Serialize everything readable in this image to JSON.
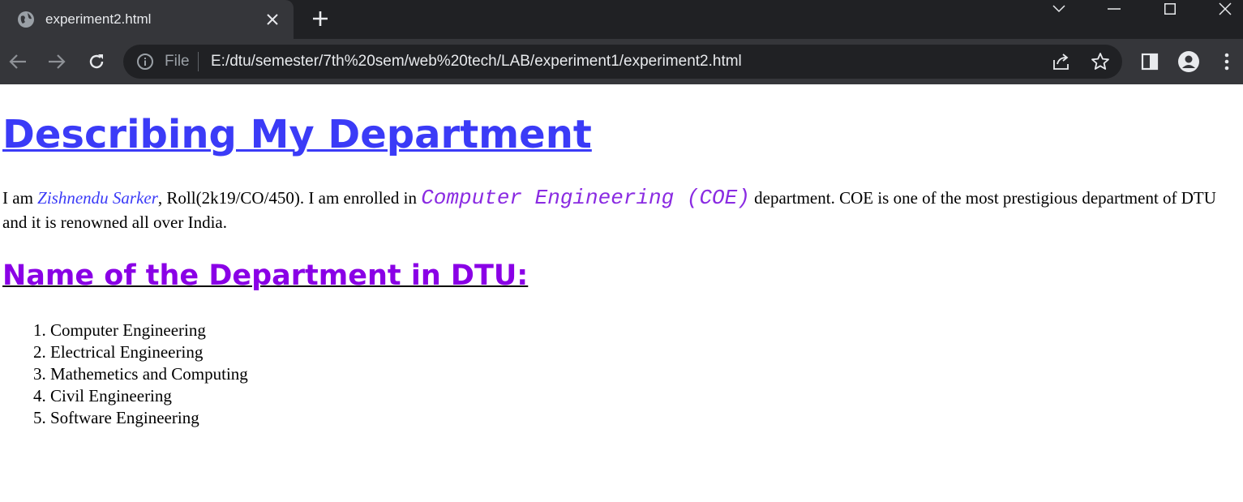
{
  "browser": {
    "tab_title": "experiment2.html",
    "scheme_label": "File",
    "url": "E:/dtu/semester/7th%20sem/web%20tech/LAB/experiment1/experiment2.html",
    "colors": {
      "tabbar": "#202124",
      "toolbar": "#35363a",
      "omnibox": "#202124"
    }
  },
  "page": {
    "title": "Describing My Department",
    "intro": {
      "part1": "I am ",
      "name": "Zishnendu Sarker",
      "part2": ", Roll(2k19/CO/450). I am enrolled in ",
      "department": "Computer Engineering (COE)",
      "part3": " department. COE is one of the most prestigious department of DTU and it is renowned all over India."
    },
    "section_title": "Name of the Department in DTU:",
    "departments": [
      "Computer Engineering",
      "Electrical Engineering",
      "Mathemetics and Computing",
      "Civil Engineering",
      "Software Engineering"
    ],
    "colors": {
      "title": "#3b3bf7",
      "section": "#8a00e6",
      "dept_code": "#8a2be2"
    }
  }
}
